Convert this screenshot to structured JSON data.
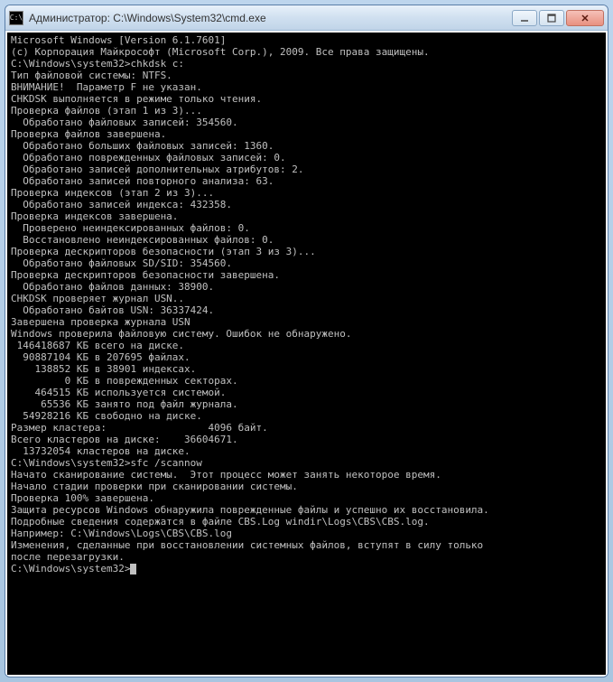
{
  "window": {
    "title": "Администратор: C:\\Windows\\System32\\cmd.exe",
    "icon_label": "C:\\"
  },
  "console": {
    "lines": [
      "Microsoft Windows [Version 6.1.7601]",
      "(c) Корпорация Майкрософт (Microsoft Corp.), 2009. Все права защищены.",
      "",
      "C:\\Windows\\system32>chkdsk c:",
      "Тип файловой системы: NTFS.",
      "",
      "ВНИМАНИЕ!  Параметр F не указан.",
      "CHKDSK выполняется в режиме только чтения.",
      "",
      "Проверка файлов (этап 1 из 3)...",
      "  Обработано файловых записей: 354560.",
      "Проверка файлов завершена.",
      "  Обработано больших файловых записей: 1360.",
      "  Обработано поврежденных файловых записей: 0.",
      "  Обработано записей дополнительных атрибутов: 2.",
      "  Обработано записей повторного анализа: 63.",
      "Проверка индексов (этап 2 из 3)...",
      "  Обработано записей индекса: 432358.",
      "Проверка индексов завершена.",
      "  Проверено неиндексированных файлов: 0.",
      "  Восстановлено неиндексированных файлов: 0.",
      "Проверка дескрипторов безопасности (этап 3 из 3)...",
      "  Обработано файловых SD/SID: 354560.",
      "Проверка дескрипторов безопасности завершена.",
      "  Обработано файлов данных: 38900.",
      "CHKDSK проверяет журнал USN..",
      "  Обработано байтов USN: 36337424.",
      "Завершена проверка журнала USN",
      "Windows проверила файловую систему. Ошибок не обнаружено.",
      "",
      " 146418687 КБ всего на диске.",
      "  90887104 КБ в 207695 файлах.",
      "    138852 КБ в 38901 индексах.",
      "         0 КБ в поврежденных секторах.",
      "    464515 КБ используется системой.",
      "     65536 КБ занято под файл журнала.",
      "  54928216 КБ свободно на диске.",
      "",
      "Размер кластера:                 4096 байт.",
      "Всего кластеров на диске:    36604671.",
      "  13732054 кластеров на диске.",
      "",
      "C:\\Windows\\system32>sfc /scannow",
      "",
      "Начато сканирование системы.  Этот процесс может занять некоторое время.",
      "",
      "Начало стадии проверки при сканировании системы.",
      "Проверка 100% завершена.",
      "",
      "Защита ресурсов Windows обнаружила поврежденные файлы и успешно их восстановила.",
      "",
      "Подробные сведения содержатся в файле CBS.Log windir\\Logs\\CBS\\CBS.log.",
      "Например: C:\\Windows\\Logs\\CBS\\CBS.log",
      "",
      "Изменения, сделанные при восстановлении системных файлов, вступят в силу только",
      "после перезагрузки.",
      "",
      "C:\\Windows\\system32>"
    ]
  }
}
